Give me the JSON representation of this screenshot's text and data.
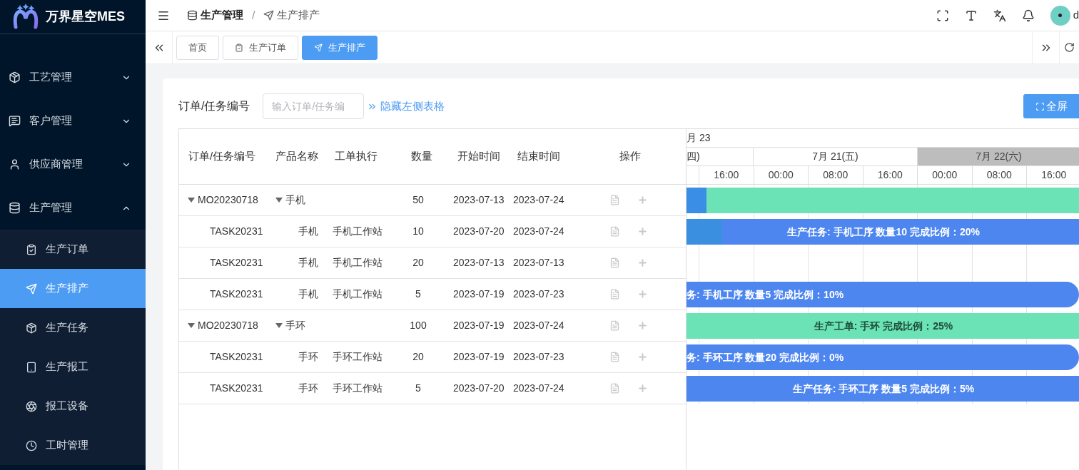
{
  "app": {
    "name": "万界星空MES"
  },
  "sidebar": {
    "items": [
      {
        "label": "工艺管理",
        "expanded": false
      },
      {
        "label": "客户管理",
        "expanded": false
      },
      {
        "label": "供应商管理",
        "expanded": false
      },
      {
        "label": "生产管理",
        "expanded": true,
        "children": [
          {
            "label": "生产订单",
            "selected": false
          },
          {
            "label": "生产排产",
            "selected": true
          },
          {
            "label": "生产任务",
            "selected": false
          },
          {
            "label": "生产报工",
            "selected": false
          },
          {
            "label": "报工设备",
            "selected": false
          },
          {
            "label": "工时管理",
            "selected": false
          }
        ]
      }
    ]
  },
  "header": {
    "breadcrumb": [
      "生产管理",
      "生产排产"
    ],
    "separator": "/",
    "user": "d"
  },
  "tabs": [
    {
      "label": "首页",
      "selected": false
    },
    {
      "label": "生产订单",
      "selected": false
    },
    {
      "label": "生产排产",
      "selected": true
    }
  ],
  "search": {
    "label": "订单/任务编号",
    "placeholder": "输入订单/任务编",
    "toggle_link": "隐藏左侧表格",
    "fullscreen_button": "全屏"
  },
  "table": {
    "columns": [
      "订单/任务编号",
      "产品名称",
      "工单执行",
      "数量",
      "开始时间",
      "结束时间",
      "操作"
    ],
    "rows": [
      {
        "kind": "order",
        "expanded": true,
        "cells": [
          "MO20230718",
          "手机",
          "",
          "50",
          "2023-07-13",
          "2023-07-24"
        ],
        "bar": {
          "kind": "order",
          "level": 0.05,
          "ends_in_view": false
        },
        "children": [
          {
            "kind": "task",
            "cells": [
              "TASK20231",
              "手机",
              "手机工作站",
              "10",
              "2023-07-20",
              "2023-07-24"
            ],
            "bar": {
              "kind": "task",
              "level": 0.09,
              "text": "生产任务: 手机工序 数量10 完成比例：20%",
              "ends_in_view": false,
              "starts_before_view": false
            }
          },
          {
            "kind": "task",
            "cells": [
              "TASK20231",
              "手机",
              "手机工作站",
              "20",
              "2023-07-13",
              "2023-07-13"
            ]
          },
          {
            "kind": "task",
            "cells": [
              "TASK20231",
              "手机",
              "手机工作站",
              "5",
              "2023-07-19",
              "2023-07-23"
            ],
            "bar": {
              "kind": "task",
              "text": "务: 手机工序 数量5 完成比例：10%",
              "ends_in_view": true,
              "starts_before_view": true
            }
          }
        ]
      },
      {
        "kind": "order",
        "expanded": true,
        "cells": [
          "MO20230718",
          "手环",
          "",
          "100",
          "2023-07-19",
          "2023-07-24"
        ],
        "bar": {
          "kind": "order",
          "text": "生产工单: 手环 完成比例：25%",
          "ends_in_view": false,
          "starts_before_view": false
        },
        "children": [
          {
            "kind": "task",
            "cells": [
              "TASK20231",
              "手环",
              "手环工作站",
              "20",
              "2023-07-19",
              "2023-07-23"
            ],
            "bar": {
              "kind": "task",
              "text": "务: 手环工序 数量20 完成比例：0%",
              "ends_in_view": true,
              "starts_before_view": true
            }
          },
          {
            "kind": "task",
            "cells": [
              "TASK20231",
              "手环",
              "手环工作站",
              "5",
              "2023-07-20",
              "2023-07-24"
            ],
            "bar": {
              "kind": "task",
              "text": "生产任务: 手环工序 数量5 完成比例：5%",
              "ends_in_view": false,
              "starts_before_view": false
            }
          }
        ]
      }
    ]
  },
  "gantt": {
    "month_label": "月 23",
    "days": [
      {
        "label": "四)",
        "weekend": false
      },
      {
        "label": "7月 21(五)",
        "weekend": false
      },
      {
        "label": "7月 22(六)",
        "weekend": true
      }
    ],
    "hours": [
      "16:00",
      "00:00",
      "08:00",
      "16:00",
      "00:00",
      "08:00",
      "16:00"
    ]
  }
}
